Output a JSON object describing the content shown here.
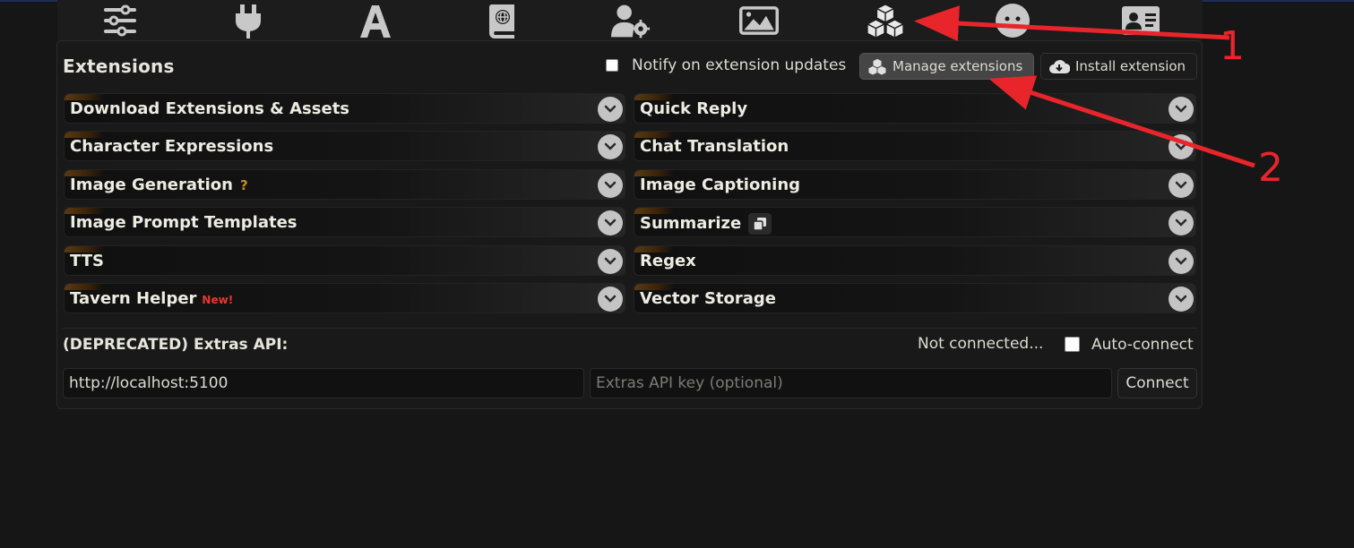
{
  "nav": {
    "icons": [
      "sliders-icon",
      "plug-icon",
      "font-icon",
      "book-globe-icon",
      "user-gear-icon",
      "image-icon",
      "cubes-icon",
      "robot-face-icon",
      "id-card-icon"
    ],
    "active": "cubes-icon"
  },
  "extensions": {
    "title": "Extensions",
    "notify_label": "Notify on extension updates",
    "notify_checked": false,
    "manage_label": "Manage extensions",
    "install_label": "Install extension"
  },
  "drawers_left": [
    {
      "label": "Download Extensions & Assets"
    },
    {
      "label": "Character Expressions"
    },
    {
      "label": "Image Generation",
      "help": "?"
    },
    {
      "label": "Image Prompt Templates"
    },
    {
      "label": "TTS"
    },
    {
      "label": "Tavern Helper",
      "badge": "New!"
    }
  ],
  "drawers_right": [
    {
      "label": "Quick Reply"
    },
    {
      "label": "Chat Translation"
    },
    {
      "label": "Image Captioning"
    },
    {
      "label": "Summarize"
    },
    {
      "label": "Regex"
    },
    {
      "label": "Vector Storage"
    }
  ],
  "extras": {
    "title": "(DEPRECATED) Extras API:",
    "status": "Not connected...",
    "autoconnect_label": "Auto-connect",
    "url_value": "http://localhost:5100",
    "key_placeholder": "Extras API key (optional)",
    "connect_label": "Connect"
  },
  "annotations": [
    "1",
    "2"
  ],
  "colors": {
    "accent_red": "#e8252b",
    "background": "#161616"
  }
}
